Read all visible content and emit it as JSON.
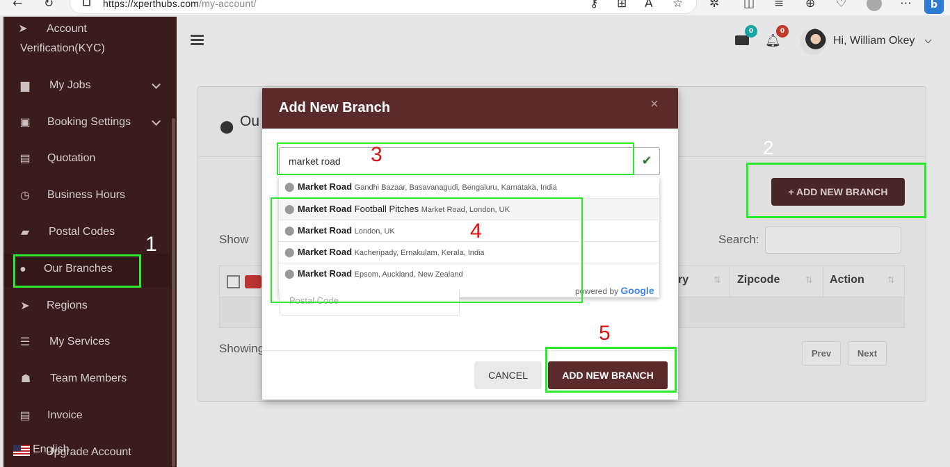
{
  "browser": {
    "url_host": "https://xperthubs.com",
    "url_path": "/my-account/"
  },
  "sidebar": {
    "items": [
      {
        "label": "Account",
        "label2": "Verification(KYC)",
        "icon": "send-icon"
      },
      {
        "label": "My Jobs",
        "icon": "briefcase-icon",
        "expandable": true
      },
      {
        "label": "Booking Settings",
        "icon": "money-icon",
        "expandable": true
      },
      {
        "label": "Quotation",
        "icon": "document-icon"
      },
      {
        "label": "Business Hours",
        "icon": "clock-icon"
      },
      {
        "label": "Postal Codes",
        "icon": "book-icon"
      },
      {
        "label": "Our Branches",
        "icon": "map-pin-icon",
        "active": true
      },
      {
        "label": "Regions",
        "icon": "send-icon"
      },
      {
        "label": "My Services",
        "icon": "server-icon"
      },
      {
        "label": "Team Members",
        "icon": "users-icon"
      },
      {
        "label": "Invoice",
        "icon": "document-icon"
      },
      {
        "label": "Upgrade Account",
        "icon": "upgrade-icon"
      }
    ],
    "language": "English"
  },
  "header": {
    "mail_count": "0",
    "bell_count": "0",
    "greeting": "Hi, William Okey"
  },
  "page": {
    "title": "Ou",
    "add_button": "+ ADD NEW BRANCH",
    "show_label": "Show",
    "search_label": "Search:",
    "columns": [
      "ry",
      "Zipcode",
      "Action"
    ],
    "showing": "Showing",
    "prev": "Prev",
    "next": "Next"
  },
  "modal": {
    "title": "Add New Branch",
    "close": "×",
    "address_value": "market road",
    "suggestions": [
      {
        "main": "Market Road",
        "extra": "",
        "secondary": "Gandhi Bazaar, Basavanagudi, Bengaluru, Karnataka, India"
      },
      {
        "main": "Market Road",
        "extra": " Football Pitches",
        "secondary": "Market Road, London, UK"
      },
      {
        "main": "Market Road",
        "extra": "",
        "secondary": "London, UK"
      },
      {
        "main": "Market Road",
        "extra": "",
        "secondary": "Kacheripady, Ernakulam, Kerala, India"
      },
      {
        "main": "Market Road",
        "extra": "",
        "secondary": "Epsom, Auckland, New Zealand"
      }
    ],
    "powered_by": "powered by",
    "google": "Google",
    "postal_placeholder": "Postal Code",
    "cancel": "CANCEL",
    "add": "ADD NEW BRANCH"
  },
  "annotations": [
    "1",
    "2",
    "3",
    "4",
    "5"
  ],
  "colors": {
    "sidebar_bg": "#3b1c1c",
    "brand": "#5b2b2b",
    "annotation_box": "#2bea2b",
    "annotation_number": "#e01010"
  }
}
